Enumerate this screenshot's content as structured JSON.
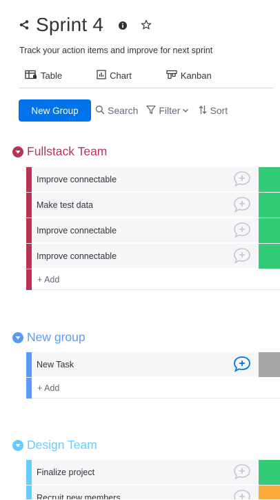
{
  "board": {
    "title": "Sprint 4",
    "description": "Track your action items and improve for next sprint"
  },
  "views": [
    {
      "label": "Table",
      "icon": "table-icon"
    },
    {
      "label": "Chart",
      "icon": "chart-icon"
    },
    {
      "label": "Kanban",
      "icon": "kanban-icon"
    }
  ],
  "toolbar": {
    "new_group_label": "New Group",
    "search_label": "Search",
    "filter_label": "Filter",
    "sort_label": "Sort"
  },
  "colors": {
    "primary": "#0073ea",
    "fullstack": "#bb3354",
    "new_group": "#579bfc",
    "design": "#66ccff",
    "status_done": "#33cc75",
    "status_empty": "#a6a6a6",
    "status_working": "#fdab3d"
  },
  "groups": [
    {
      "title": "Fullstack Team",
      "add_label": "+ Add",
      "items": [
        {
          "name": "Improve connectable",
          "status": "done"
        },
        {
          "name": "Make test data",
          "status": "done"
        },
        {
          "name": "Improve connectable",
          "status": "done"
        },
        {
          "name": "Improve connectable",
          "status": "done"
        }
      ]
    },
    {
      "title": "New group",
      "add_label": "+ Add",
      "items": [
        {
          "name": "New Task",
          "status": "empty"
        }
      ]
    },
    {
      "title": "Design Team",
      "add_label": "",
      "items": [
        {
          "name": "Finalize project",
          "status": "done"
        },
        {
          "name": "Recruit new members",
          "status": "working"
        }
      ]
    }
  ]
}
